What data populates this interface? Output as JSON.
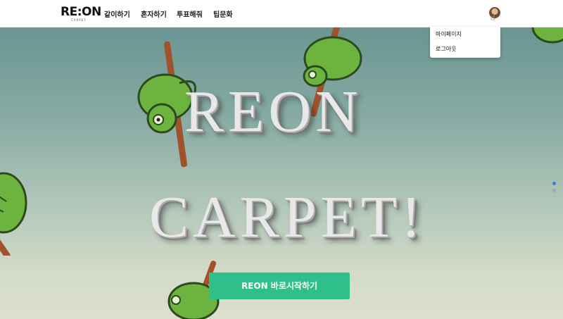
{
  "logo": {
    "text": "RE:ON",
    "sub": "CARPET"
  },
  "nav": {
    "items": [
      "같이하기",
      "혼자하기",
      "투표해줘",
      "팁문화"
    ]
  },
  "dropdown": {
    "items": [
      "마이페이지",
      "로그아웃"
    ]
  },
  "hero": {
    "title_line1": "REON",
    "title_line2": "CARPET!",
    "start_label": "REON 바로시작하기"
  },
  "colors": {
    "accent": "#2fbf8a",
    "chameleon": "#6db33f",
    "branch": "#a0522d"
  }
}
